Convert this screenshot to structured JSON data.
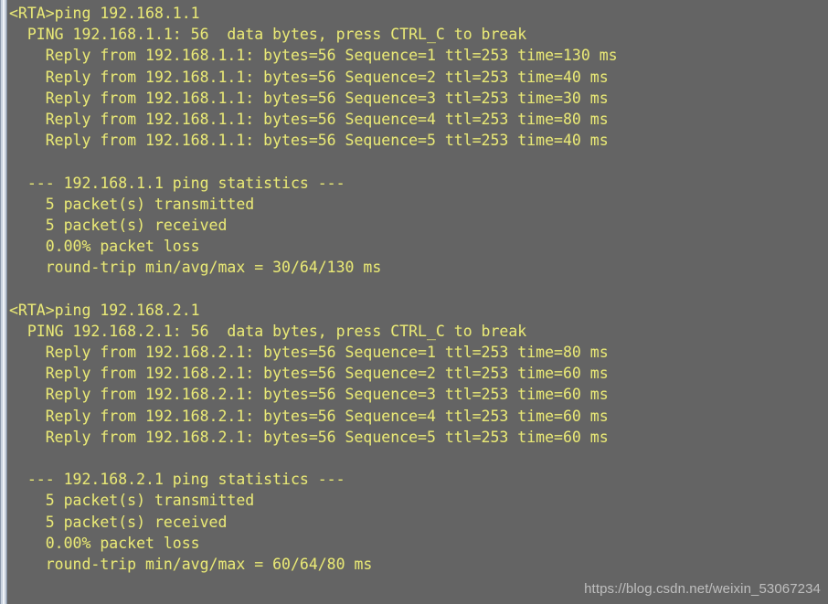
{
  "terminal": {
    "prompt": "<RTA>",
    "background_color": "#646464",
    "text_color": "#e8e87a",
    "lines": [
      "<RTA>ping 192.168.1.1",
      "  PING 192.168.1.1: 56  data bytes, press CTRL_C to break",
      "    Reply from 192.168.1.1: bytes=56 Sequence=1 ttl=253 time=130 ms",
      "    Reply from 192.168.1.1: bytes=56 Sequence=2 ttl=253 time=40 ms",
      "    Reply from 192.168.1.1: bytes=56 Sequence=3 ttl=253 time=30 ms",
      "    Reply from 192.168.1.1: bytes=56 Sequence=4 ttl=253 time=80 ms",
      "    Reply from 192.168.1.1: bytes=56 Sequence=5 ttl=253 time=40 ms",
      "",
      "  --- 192.168.1.1 ping statistics ---",
      "    5 packet(s) transmitted",
      "    5 packet(s) received",
      "    0.00% packet loss",
      "    round-trip min/avg/max = 30/64/130 ms",
      "",
      "<RTA>ping 192.168.2.1",
      "  PING 192.168.2.1: 56  data bytes, press CTRL_C to break",
      "    Reply from 192.168.2.1: bytes=56 Sequence=1 ttl=253 time=80 ms",
      "    Reply from 192.168.2.1: bytes=56 Sequence=2 ttl=253 time=60 ms",
      "    Reply from 192.168.2.1: bytes=56 Sequence=3 ttl=253 time=60 ms",
      "    Reply from 192.168.2.1: bytes=56 Sequence=4 ttl=253 time=60 ms",
      "    Reply from 192.168.2.1: bytes=56 Sequence=5 ttl=253 time=60 ms",
      "",
      "  --- 192.168.2.1 ping statistics ---",
      "    5 packet(s) transmitted",
      "    5 packet(s) received",
      "    0.00% packet loss",
      "    round-trip min/avg/max = 60/64/80 ms"
    ],
    "sessions": [
      {
        "command": "ping 192.168.1.1",
        "target": "192.168.1.1",
        "header": "PING 192.168.1.1: 56  data bytes, press CTRL_C to break",
        "data_bytes": "56",
        "replies": [
          {
            "from": "192.168.1.1",
            "bytes": "56",
            "sequence": "1",
            "ttl": "253",
            "time": "130 ms"
          },
          {
            "from": "192.168.1.1",
            "bytes": "56",
            "sequence": "2",
            "ttl": "253",
            "time": "40 ms"
          },
          {
            "from": "192.168.1.1",
            "bytes": "56",
            "sequence": "3",
            "ttl": "253",
            "time": "30 ms"
          },
          {
            "from": "192.168.1.1",
            "bytes": "56",
            "sequence": "4",
            "ttl": "253",
            "time": "80 ms"
          },
          {
            "from": "192.168.1.1",
            "bytes": "56",
            "sequence": "5",
            "ttl": "253",
            "time": "40 ms"
          }
        ],
        "statistics": {
          "title": "--- 192.168.1.1 ping statistics ---",
          "transmitted": "5 packet(s) transmitted",
          "received": "5 packet(s) received",
          "loss": "0.00% packet loss",
          "round_trip": "round-trip min/avg/max = 30/64/130 ms",
          "min": "30",
          "avg": "64",
          "max": "130"
        }
      },
      {
        "command": "ping 192.168.2.1",
        "target": "192.168.2.1",
        "header": "PING 192.168.2.1: 56  data bytes, press CTRL_C to break",
        "data_bytes": "56",
        "replies": [
          {
            "from": "192.168.2.1",
            "bytes": "56",
            "sequence": "1",
            "ttl": "253",
            "time": "80 ms"
          },
          {
            "from": "192.168.2.1",
            "bytes": "56",
            "sequence": "2",
            "ttl": "253",
            "time": "60 ms"
          },
          {
            "from": "192.168.2.1",
            "bytes": "56",
            "sequence": "3",
            "ttl": "253",
            "time": "60 ms"
          },
          {
            "from": "192.168.2.1",
            "bytes": "56",
            "sequence": "4",
            "ttl": "253",
            "time": "60 ms"
          },
          {
            "from": "192.168.2.1",
            "bytes": "56",
            "sequence": "5",
            "ttl": "253",
            "time": "60 ms"
          }
        ],
        "statistics": {
          "title": "--- 192.168.2.1 ping statistics ---",
          "transmitted": "5 packet(s) transmitted",
          "received": "5 packet(s) received",
          "loss": "0.00% packet loss",
          "round_trip": "round-trip min/avg/max = 60/64/80 ms",
          "min": "60",
          "avg": "64",
          "max": "80"
        }
      }
    ]
  },
  "watermark": {
    "text": "https://blog.csdn.net/weixin_53067234"
  }
}
